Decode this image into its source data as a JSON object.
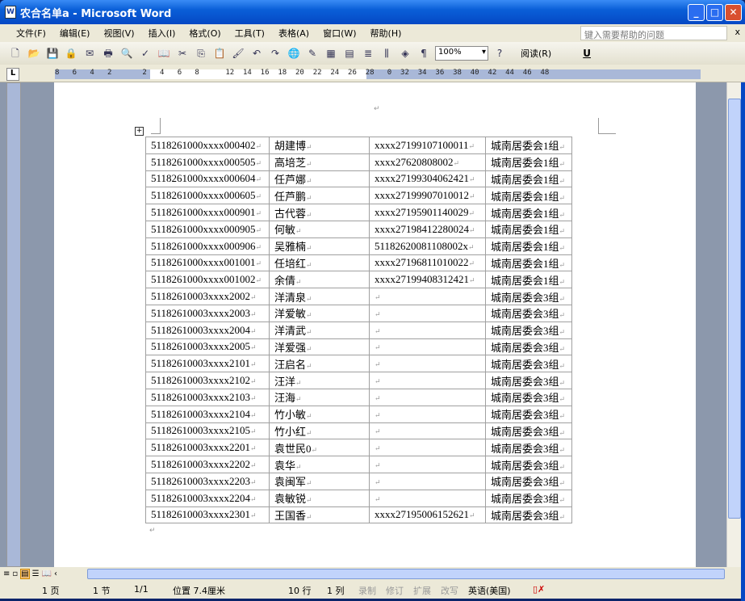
{
  "window": {
    "title": "农合名单a - Microsoft Word"
  },
  "menu": [
    "文件(F)",
    "编辑(E)",
    "视图(V)",
    "插入(I)",
    "格式(O)",
    "工具(T)",
    "表格(A)",
    "窗口(W)",
    "帮助(H)"
  ],
  "help_placeholder": "键入需要帮助的问题",
  "toolbar": {
    "zoom": "100%",
    "read_label": "阅读(R)",
    "underline": "U"
  },
  "ruler_numbers": "8   6   4   2       2   4   6   8      12  14  16  18  20  22  24  26  28   0  32  34  36  38  40  42  44  46  48",
  "table": [
    [
      "5118261000xxxx000402",
      "胡建博",
      "xxxx27199107100011",
      "城南居委会1组"
    ],
    [
      "5118261000xxxx000505",
      "高培芝",
      "xxxx27620808002",
      "城南居委会1组"
    ],
    [
      "5118261000xxxx000604",
      "任芦娜",
      "xxxx27199304062421",
      "城南居委会1组"
    ],
    [
      "5118261000xxxx000605",
      "任芦鹏",
      "xxxx27199907010012",
      "城南居委会1组"
    ],
    [
      "5118261000xxxx000901",
      "古代蓉",
      "xxxx27195901140029",
      "城南居委会1组"
    ],
    [
      "5118261000xxxx000905",
      "何敏",
      "xxxx27198412280024",
      "城南居委会1组"
    ],
    [
      "5118261000xxxx000906",
      "吴雅楠",
      "51182620081108002x",
      "城南居委会1组"
    ],
    [
      "5118261000xxxx001001",
      "任培红",
      "xxxx27196811010022",
      "城南居委会1组"
    ],
    [
      "5118261000xxxx001002",
      "余倩",
      "xxxx27199408312421",
      "城南居委会1组"
    ],
    [
      "51182610003xxxx2002",
      "洋清泉",
      "",
      "城南居委会3组"
    ],
    [
      "51182610003xxxx2003",
      "洋爱敏",
      "",
      "城南居委会3组"
    ],
    [
      "51182610003xxxx2004",
      "洋清武",
      "",
      "城南居委会3组"
    ],
    [
      "51182610003xxxx2005",
      "洋爱强",
      "",
      "城南居委会3组"
    ],
    [
      "51182610003xxxx2101",
      "汪启名",
      "",
      "城南居委会3组"
    ],
    [
      "51182610003xxxx2102",
      "汪洋",
      "",
      "城南居委会3组"
    ],
    [
      "51182610003xxxx2103",
      "汪海",
      "",
      "城南居委会3组"
    ],
    [
      "51182610003xxxx2104",
      "竹小敏",
      "",
      "城南居委会3组"
    ],
    [
      "51182610003xxxx2105",
      "竹小红",
      "",
      "城南居委会3组"
    ],
    [
      "51182610003xxxx2201",
      "袁世民0",
      "",
      "城南居委会3组"
    ],
    [
      "51182610003xxxx2202",
      "袁华",
      "",
      "城南居委会3组"
    ],
    [
      "51182610003xxxx2203",
      "袁闽军",
      "",
      "城南居委会3组"
    ],
    [
      "51182610003xxxx2204",
      "袁敏锐",
      "",
      "城南居委会3组"
    ],
    [
      "51182610003xxxx2301",
      "王国香",
      "xxxx27195006152621",
      "城南居委会3组"
    ]
  ],
  "status": {
    "page": "1 页",
    "section": "1 节",
    "pages": "1/1",
    "position": "位置 7.4厘米",
    "line": "10 行",
    "col": "1 列",
    "rec": "录制",
    "trk": "修订",
    "ext": "扩展",
    "ovr": "改写",
    "lang": "英语(美国)"
  }
}
